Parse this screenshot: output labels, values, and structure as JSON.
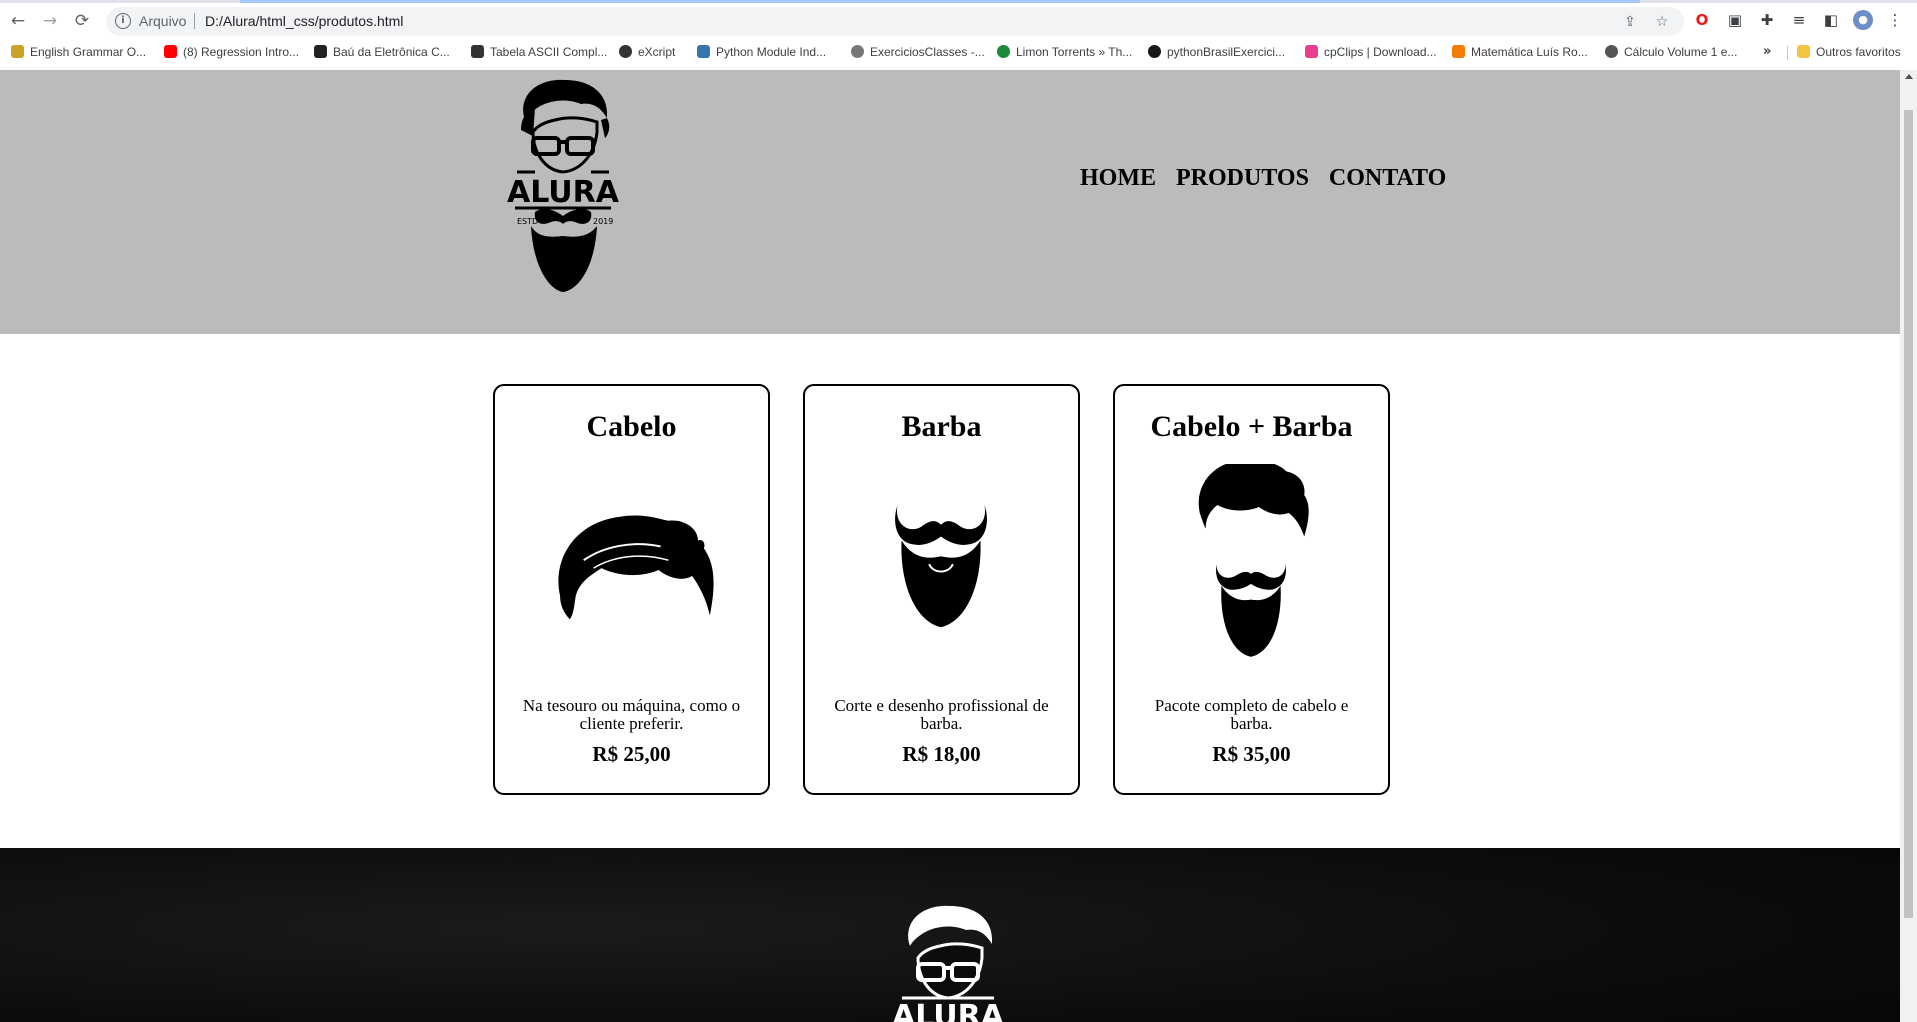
{
  "browser": {
    "nav": {
      "back": "←",
      "forward": "→",
      "reload": "⟳"
    },
    "address": {
      "scheme_label": "Arquivo",
      "url": "D:/Alura/html_css/produtos.html"
    },
    "bookmarks": [
      {
        "label": "English Grammar O...",
        "color": "#c9a227"
      },
      {
        "label": "(8) Regression Intro...",
        "color": "#ff0000"
      },
      {
        "label": "Baú da Eletrônica C...",
        "color": "#222222"
      },
      {
        "label": "Tabela ASCII Compl...",
        "color": "#333333"
      },
      {
        "label": "eXcript",
        "color": "#333333"
      },
      {
        "label": "Python Module Ind...",
        "color": "#3776ab"
      },
      {
        "label": "ExerciciosClasses -...",
        "color": "#777777"
      },
      {
        "label": "Limon Torrents » Th...",
        "color": "#1b8a3a"
      },
      {
        "label": "pythonBrasilExercici...",
        "color": "#181717"
      },
      {
        "label": "cpClips | Download...",
        "color": "#e83e8c"
      },
      {
        "label": "Matemática Luís Ro...",
        "color": "#f57c00"
      },
      {
        "label": "Cálculo Volume 1 e...",
        "color": "#555555"
      }
    ],
    "bookmarks_more": "»",
    "other_favorites": {
      "label": "Outros favoritos",
      "color": "#f4c542"
    }
  },
  "site": {
    "logo_text": "ALURA",
    "logo_estd": "ESTD",
    "logo_year": "2019",
    "menu": [
      "HOME",
      "PRODUTOS",
      "CONTATO"
    ]
  },
  "products": [
    {
      "title": "Cabelo",
      "description": "Na tesouro ou máquina, como o cliente preferir.",
      "price": "R$ 25,00"
    },
    {
      "title": "Barba",
      "description": "Corte e desenho profissional de barba.",
      "price": "R$ 18,00"
    },
    {
      "title": "Cabelo + Barba",
      "description": "Pacote completo de cabelo e barba.",
      "price": "R$ 35,00"
    }
  ],
  "footer": {
    "logo_text": "ALURA"
  }
}
